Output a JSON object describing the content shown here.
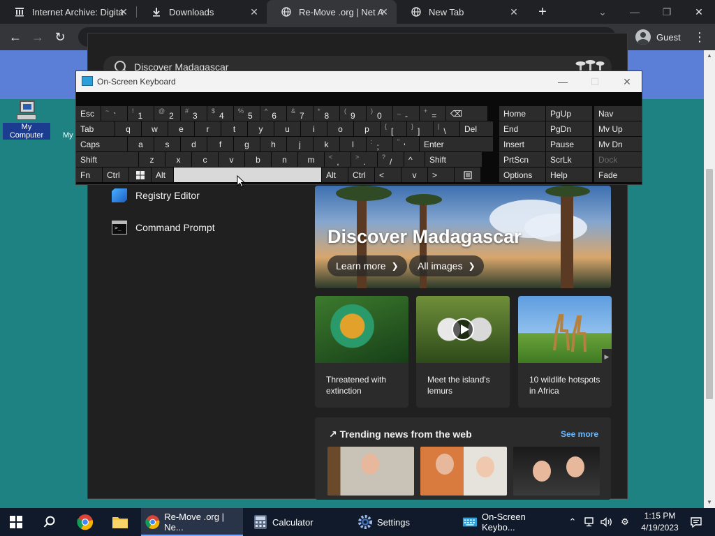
{
  "browser": {
    "tabs": [
      {
        "title": "Internet Archive: Digita",
        "icon": "archive-icon",
        "active": false
      },
      {
        "title": "Downloads",
        "icon": "download-icon",
        "active": false
      },
      {
        "title": "Re-Move .org | Net Art",
        "icon": "globe-icon",
        "active": true
      },
      {
        "title": "New Tab",
        "icon": "globe-icon",
        "active": false
      }
    ],
    "profile_label": "Guest"
  },
  "desktop": {
    "icon_label": "My Computer",
    "partial_label": "My"
  },
  "search_panel": {
    "query": "Discover Madagascar",
    "apps": [
      {
        "label": "Registry Editor",
        "icon": "registry-editor-icon"
      },
      {
        "label": "Command Prompt",
        "icon": "command-prompt-icon"
      }
    ],
    "hero": {
      "title": "Discover Madagascar",
      "learn_more": "Learn more",
      "all_images": "All images"
    },
    "cards": [
      {
        "caption": "Threatened with extinction"
      },
      {
        "caption": "Meet the island's lemurs"
      },
      {
        "caption": "10 wildlife hotspots in Africa"
      }
    ],
    "trending": {
      "title": "Trending news from the web",
      "see_more": "See more"
    }
  },
  "osk": {
    "title": "On-Screen Keyboard",
    "row1": [
      {
        "label": "Esc"
      },
      {
        "sub": "~",
        "main": "`"
      },
      {
        "sub": "!",
        "main": "1"
      },
      {
        "sub": "@",
        "main": "2"
      },
      {
        "sub": "#",
        "main": "3"
      },
      {
        "sub": "$",
        "main": "4"
      },
      {
        "sub": "%",
        "main": "5"
      },
      {
        "sub": "^",
        "main": "6"
      },
      {
        "sub": "&",
        "main": "7"
      },
      {
        "sub": "*",
        "main": "8"
      },
      {
        "sub": "(",
        "main": "9"
      },
      {
        "sub": ")",
        "main": "0"
      },
      {
        "sub": "_",
        "main": "-"
      },
      {
        "sub": "+",
        "main": "="
      },
      {
        "label": "⌫"
      }
    ],
    "row2": [
      {
        "label": "Tab"
      },
      {
        "label": "q"
      },
      {
        "label": "w"
      },
      {
        "label": "e"
      },
      {
        "label": "r"
      },
      {
        "label": "t"
      },
      {
        "label": "y"
      },
      {
        "label": "u"
      },
      {
        "label": "i"
      },
      {
        "label": "o"
      },
      {
        "label": "p"
      },
      {
        "sub": "{",
        "main": "["
      },
      {
        "sub": "}",
        "main": "]"
      },
      {
        "sub": "|",
        "main": "\\"
      },
      {
        "label": "Del"
      }
    ],
    "row3": [
      {
        "label": "Caps"
      },
      {
        "label": "a"
      },
      {
        "label": "s"
      },
      {
        "label": "d"
      },
      {
        "label": "f"
      },
      {
        "label": "g"
      },
      {
        "label": "h"
      },
      {
        "label": "j"
      },
      {
        "label": "k"
      },
      {
        "label": "l"
      },
      {
        "sub": ":",
        "main": ";"
      },
      {
        "sub": "\"",
        "main": "'"
      },
      {
        "label": "Enter"
      }
    ],
    "row4": [
      {
        "label": "Shift"
      },
      {
        "label": "z"
      },
      {
        "label": "x"
      },
      {
        "label": "c"
      },
      {
        "label": "v"
      },
      {
        "label": "b"
      },
      {
        "label": "n"
      },
      {
        "label": "m"
      },
      {
        "sub": "<",
        "main": ","
      },
      {
        "sub": ">",
        "main": "."
      },
      {
        "sub": "?",
        "main": "/"
      },
      {
        "label": "^"
      },
      {
        "label": "Shift"
      }
    ],
    "row5": [
      {
        "label": "Fn"
      },
      {
        "label": "Ctrl"
      },
      {
        "label": "windows-icon"
      },
      {
        "label": "Alt"
      },
      {
        "label": ""
      },
      {
        "label": "Alt"
      },
      {
        "label": "Ctrl"
      },
      {
        "label": "<"
      },
      {
        "label": "v"
      },
      {
        "label": ">"
      },
      {
        "label": "menu-icon"
      }
    ],
    "nav_col1": [
      "Home",
      "End",
      "Insert",
      "PrtScn",
      "Options"
    ],
    "nav_col2": [
      "PgUp",
      "PgDn",
      "Pause",
      "ScrLk",
      "Help"
    ],
    "nav_col3": [
      "Nav",
      "Mv Up",
      "Mv Dn",
      "Dock",
      "Fade"
    ]
  },
  "taskbar": {
    "items": [
      {
        "label": "Re-Move .org | Ne...",
        "icon": "chrome-icon",
        "active": true
      },
      {
        "label": "Calculator",
        "icon": "calculator-icon",
        "active": false
      },
      {
        "label": "Settings",
        "icon": "settings-gear-icon",
        "active": false
      },
      {
        "label": "On-Screen Keybo...",
        "icon": "keyboard-icon",
        "active": false
      }
    ],
    "time": "1:15 PM",
    "date": "4/19/2023"
  },
  "colors": {
    "desktop": "#1f8282",
    "banner": "#5b7fd6",
    "panel": "#202020",
    "link": "#6cb8ff",
    "taskbar": "#101a2a"
  }
}
